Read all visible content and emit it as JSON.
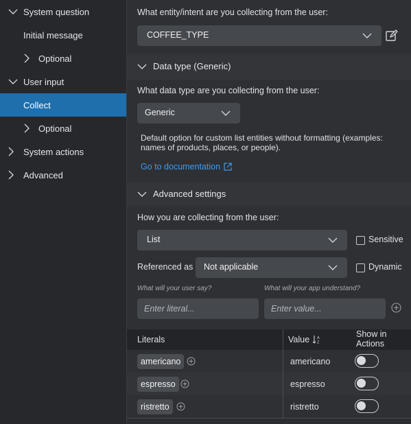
{
  "sidebar": {
    "items": [
      {
        "label": "System question",
        "chevron": "chevron-down-icon",
        "expanded": true
      },
      {
        "label": "Initial message"
      },
      {
        "label": "Optional",
        "chevron": "chevron-right-icon",
        "expanded": false
      },
      {
        "label": "User input",
        "chevron": "chevron-down-icon",
        "expanded": true
      },
      {
        "label": "Collect",
        "active": true
      },
      {
        "label": "Optional",
        "chevron": "chevron-right-icon",
        "expanded": false
      },
      {
        "label": "System actions",
        "chevron": "chevron-right-icon",
        "expanded": false
      },
      {
        "label": "Advanced",
        "chevron": "chevron-right-icon",
        "expanded": false
      }
    ]
  },
  "entity": {
    "question": "What entity/intent are you collecting from the user:",
    "selected": "COFFEE_TYPE",
    "edit_icon": "edit-icon"
  },
  "data_type": {
    "header": "Data type (Generic)",
    "question": "What data type are you collecting from the user:",
    "selected": "Generic",
    "description": "Default option for custom list entities without formatting (examples: names of products, places, or people).",
    "doc_link": "Go to documentation",
    "link_icon": "external-link-icon"
  },
  "advanced_settings": {
    "header": "Advanced settings",
    "question": "How you are collecting from the user:",
    "collect_mode": "List",
    "sensitive_label": "Sensitive",
    "sensitive_checked": false,
    "referenced_label": "Referenced as",
    "referenced_value": "Not applicable",
    "dynamic_label": "Dynamic",
    "dynamic_checked": false,
    "user_say_label": "What will your user say?",
    "app_understand_label": "What will your app understand?",
    "literal_placeholder": "Enter literal...",
    "value_placeholder": "Enter value...",
    "add_icon": "add-circle-icon"
  },
  "table": {
    "headers": {
      "literals": "Literals",
      "value": "Value",
      "show_actions": "Show in Actions"
    },
    "sort_icon": "sort-icon",
    "rows": [
      {
        "literal": "americano",
        "value": "americano",
        "show": false
      },
      {
        "literal": "espresso",
        "value": "espresso",
        "show": false
      },
      {
        "literal": "ristretto",
        "value": "ristretto",
        "show": false
      }
    ]
  },
  "colors": {
    "active_item": "#1f6fad",
    "link": "#3f9bf0",
    "field_bg": "#45484d"
  }
}
